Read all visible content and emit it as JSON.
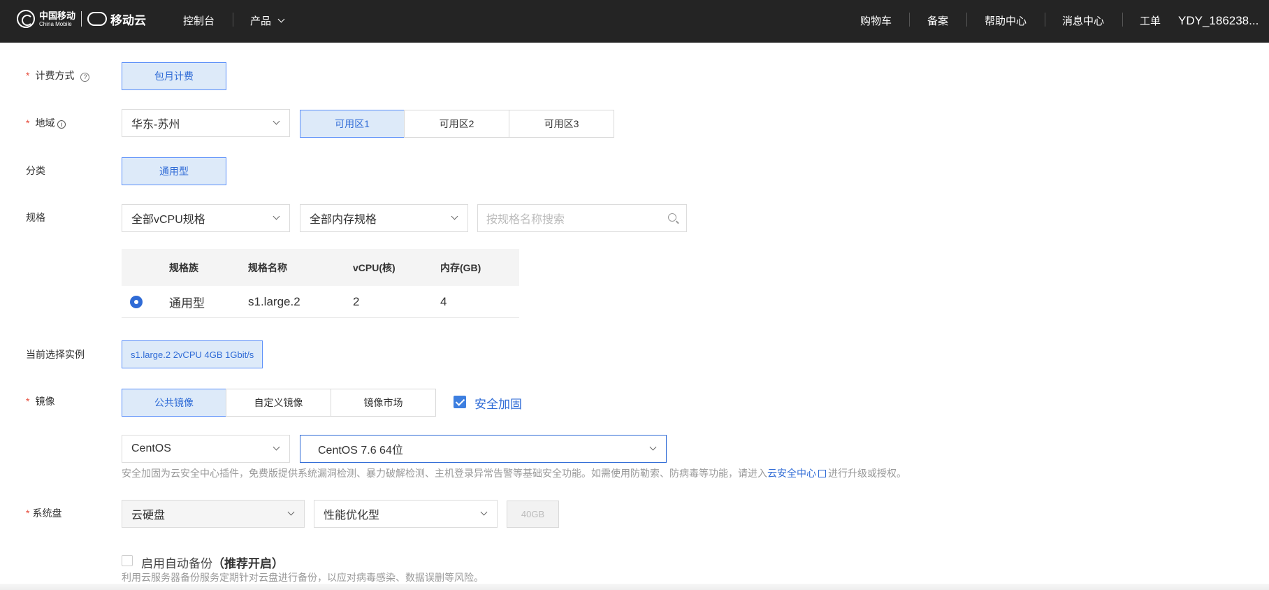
{
  "header": {
    "logo_cn": "中国移动",
    "logo_en": "China Mobile",
    "brand": "移动云",
    "nav_console": "控制台",
    "nav_products": "产品",
    "nav_cart": "购物车",
    "nav_filing": "备案",
    "nav_help": "帮助中心",
    "nav_messages": "消息中心",
    "nav_tickets": "工单",
    "user": "YDY_186238..."
  },
  "billing": {
    "label": "计费方式",
    "required": "*",
    "help_icon": "?",
    "option": "包月计费"
  },
  "region": {
    "label": "地域",
    "required": "*",
    "info_icon": "i",
    "value": "华东-苏州",
    "zones": [
      "可用区1",
      "可用区2",
      "可用区3"
    ],
    "selected_zone": "可用区1"
  },
  "category": {
    "label": "分类",
    "option": "通用型"
  },
  "spec": {
    "label": "规格",
    "vcpu_filter": "全部vCPU规格",
    "memory_filter": "全部内存规格",
    "search_placeholder": "按规格名称搜索",
    "table": {
      "headers": [
        "规格族",
        "规格名称",
        "vCPU(核)",
        "内存(GB)"
      ],
      "rows": [
        {
          "family": "通用型",
          "name": "s1.large.2",
          "vcpu": "2",
          "memory": "4",
          "selected": true
        }
      ]
    }
  },
  "current_instance": {
    "label": "当前选择实例",
    "value": "s1.large.2 2vCPU 4GB 1Gbit/s"
  },
  "image": {
    "label": "镜像",
    "required": "*",
    "tabs": [
      "公共镜像",
      "自定义镜像",
      "镜像市场"
    ],
    "selected_tab": "公共镜像",
    "security_label": "安全加固",
    "security_checked": true,
    "os": "CentOS",
    "version": "CentOS 7.6 64位",
    "note_prefix": "安全加固为云安全中心插件，免费版提供系统漏洞检测、暴力破解检测、主机登录异常告警等基础安全功能。如需使用防勒索、防病毒等功能，请进入",
    "note_link": "云安全中心",
    "note_suffix": "进行升级或授权。"
  },
  "system_disk": {
    "label": "系统盘",
    "required": "*",
    "type": "云硬盘",
    "performance": "性能优化型",
    "size": "40GB",
    "backup_label": "启用自动备份",
    "backup_recommend": "（推荐开启）",
    "backup_checked": false,
    "backup_note": "利用云服务器备份服务定期针对云盘进行备份，以应对病毒感染、数据误删等风险。"
  },
  "colors": {
    "topbar": "#242424",
    "accent": "#2f6bd6",
    "selected_bg": "#ddeaf9",
    "required": "#e74c3c"
  }
}
